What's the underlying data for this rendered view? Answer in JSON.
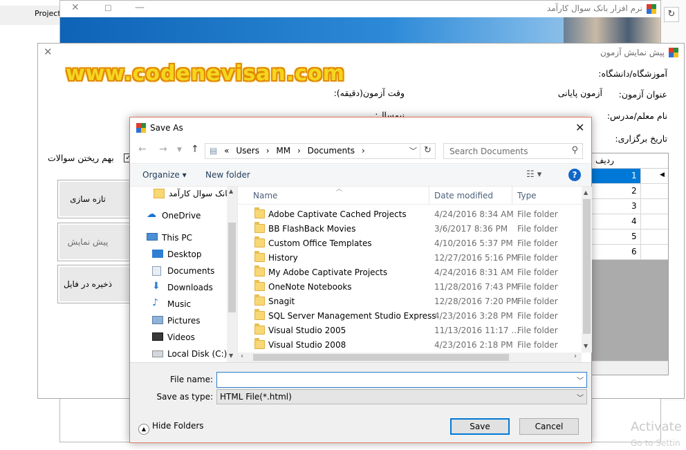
{
  "background": {
    "project_label": "Project",
    "refresh_icon": "refresh-icon"
  },
  "main_window": {
    "title": "نرم افزار بانک سوال کارآمد"
  },
  "preview_window": {
    "title": "پیش نمایش آزمون",
    "watermark": "www.codenevisan.com",
    "labels": {
      "institute": "آموزشگاه/دانشگاه:",
      "exam_title": "عنوان آزمون:",
      "exam_title_value": "آزمون پایانی",
      "exam_time": "وقت آزمون(دقیقه):",
      "teacher": "نام معلم/مدرس:",
      "semester": "نیمسال:",
      "date": "تاریخ برگزاری:",
      "shuffle": "بهم ریختن سوالات"
    },
    "buttons": {
      "refresh": "تازه سازی",
      "preview": "پیش نمایش",
      "save_file": "ذخیره در فایل"
    },
    "grid": {
      "header": "ردیف",
      "rows": [
        "1",
        "2",
        "3",
        "4",
        "5",
        "6"
      ]
    }
  },
  "dialog": {
    "title": "Save As",
    "breadcrumb": [
      "«",
      "Users",
      "›",
      "MM",
      "›",
      "Documents",
      "›"
    ],
    "search_placeholder": "Search Documents",
    "toolbar": {
      "organize": "Organize ▾",
      "new_folder": "New folder",
      "help": "?"
    },
    "nav_items": [
      {
        "label": "بانک سوال کارآمد",
        "icon": "folder-icon"
      },
      {
        "label": "OneDrive",
        "icon": "cloud-icon"
      },
      {
        "label": "This PC",
        "icon": "computer-icon"
      },
      {
        "label": "Desktop",
        "icon": "desktop-icon"
      },
      {
        "label": "Documents",
        "icon": "documents-icon"
      },
      {
        "label": "Downloads",
        "icon": "download-icon"
      },
      {
        "label": "Music",
        "icon": "music-icon"
      },
      {
        "label": "Pictures",
        "icon": "pictures-icon"
      },
      {
        "label": "Videos",
        "icon": "videos-icon"
      },
      {
        "label": "Local Disk (C:)",
        "icon": "disk-icon"
      }
    ],
    "columns": {
      "name": "Name",
      "date": "Date modified",
      "type": "Type"
    },
    "files": [
      {
        "name": "Adobe Captivate Cached Projects",
        "date": "4/24/2016 8:34 AM",
        "type": "File folder"
      },
      {
        "name": "BB FlashBack Movies",
        "date": "3/6/2017 8:36 PM",
        "type": "File folder"
      },
      {
        "name": "Custom Office Templates",
        "date": "4/10/2016 5:37 PM",
        "type": "File folder"
      },
      {
        "name": "History",
        "date": "12/27/2016 5:16 PM",
        "type": "File folder"
      },
      {
        "name": "My Adobe Captivate Projects",
        "date": "4/24/2016 8:31 AM",
        "type": "File folder"
      },
      {
        "name": "OneNote Notebooks",
        "date": "11/28/2016 7:43 PM",
        "type": "File folder"
      },
      {
        "name": "Snagit",
        "date": "12/28/2016 7:20 PM",
        "type": "File folder"
      },
      {
        "name": "SQL Server Management Studio Express",
        "date": "4/23/2016 3:28 PM",
        "type": "File folder"
      },
      {
        "name": "Visual Studio 2005",
        "date": "11/13/2016 11:17 ...",
        "type": "File folder"
      },
      {
        "name": "Visual Studio 2008",
        "date": "4/23/2016 2:18 PM",
        "type": "File folder"
      }
    ],
    "file_name_label": "File name:",
    "file_name_value": "",
    "save_type_label": "Save as type:",
    "save_type_value": "HTML File(*.html)",
    "hide_folders": "Hide Folders",
    "save_button": "Save",
    "cancel_button": "Cancel"
  },
  "activation": {
    "line1": "Activate W",
    "line2": "Go to Settin"
  },
  "colors": {
    "selection": "#0078d7",
    "nav_selected": "#cce8ff",
    "watermark": "#f5d520",
    "dialog_border": "#e07b5e"
  }
}
